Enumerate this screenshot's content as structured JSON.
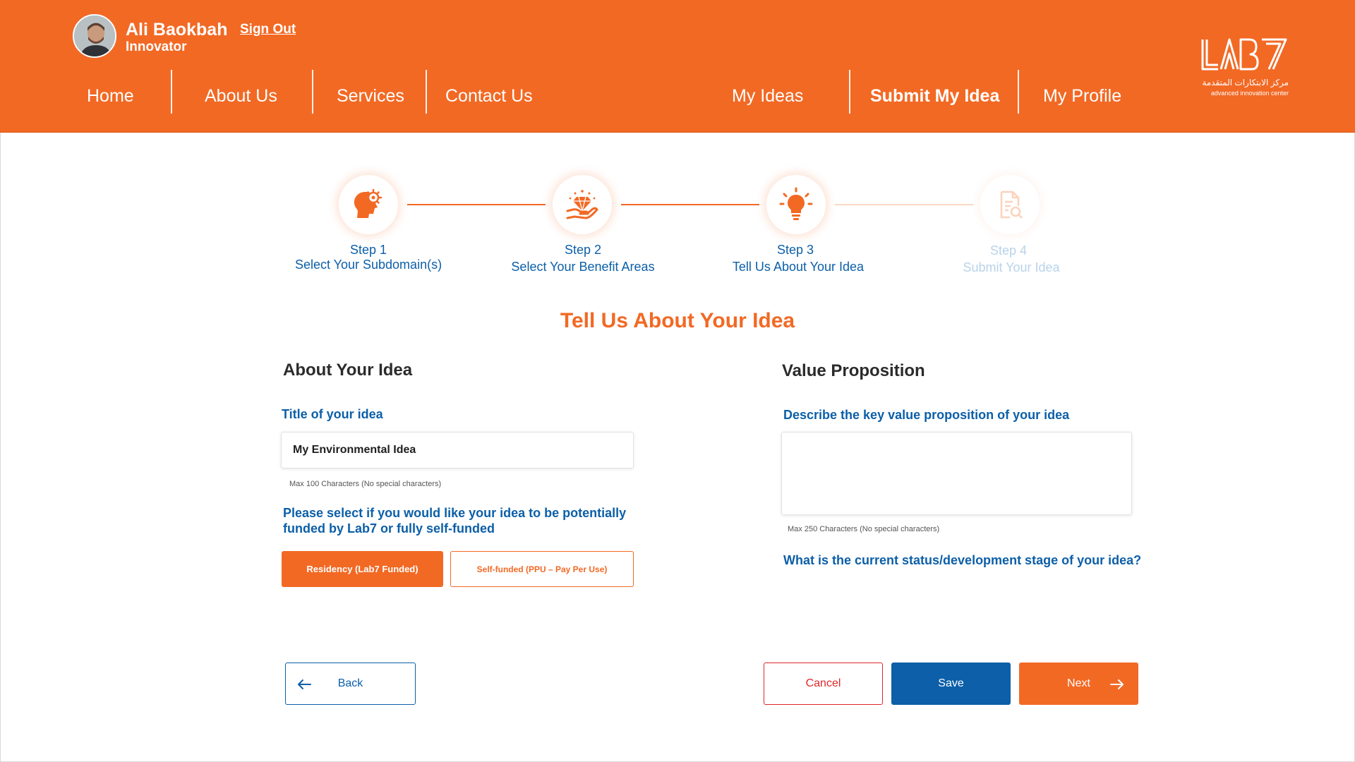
{
  "user": {
    "name": "Ali Baokbah",
    "role": "Innovator",
    "signout_label": "Sign Out"
  },
  "nav": {
    "home": "Home",
    "about": "About Us",
    "services": "Services",
    "contact": "Contact Us",
    "my_ideas": "My Ideas",
    "submit_idea": "Submit My Idea",
    "my_profile": "My Profile"
  },
  "logo": {
    "text": "LAB7",
    "arabic": "مركز الابتكارات المتقدمة",
    "english": "advanced innovation center"
  },
  "steps": [
    {
      "number": "Step 1",
      "title": "Select Your Subdomain(s)",
      "icon": "head-gear-icon",
      "state": "done"
    },
    {
      "number": "Step 2",
      "title": "Select Your Benefit Areas",
      "icon": "hand-diamond-icon",
      "state": "done"
    },
    {
      "number": "Step 3",
      "title": "Tell Us About Your Idea",
      "icon": "lightbulb-icon",
      "state": "current"
    },
    {
      "number": "Step 4",
      "title": "Submit Your Idea",
      "icon": "document-search-icon",
      "state": "pending"
    }
  ],
  "page_title": "Tell Us About Your Idea",
  "about": {
    "heading": "About Your Idea",
    "title_label": "Title of your idea",
    "title_value": "My Environmental Idea",
    "title_hint": "Max 100 Characters (No special characters)",
    "funding_label": "Please select if you would like your idea to be potentially funded by Lab7 or fully self-funded",
    "funding_options": [
      {
        "label": "Residency (Lab7 Funded)",
        "selected": true
      },
      {
        "label": "Self-funded (PPU – Pay Per Use)",
        "selected": false
      }
    ]
  },
  "value": {
    "heading": "Value Proposition",
    "vp_label": "Describe the key value proposition of your idea",
    "vp_value": "",
    "vp_hint": "Max 250 Characters (No special characters)",
    "status_label": "What is the current status/development stage of your idea?"
  },
  "actions": {
    "back": "Back",
    "cancel": "Cancel",
    "save": "Save",
    "next": "Next"
  },
  "colors": {
    "brand_orange": "#f26924",
    "brand_blue": "#0c5fa8",
    "cancel_red": "#e0262a"
  }
}
